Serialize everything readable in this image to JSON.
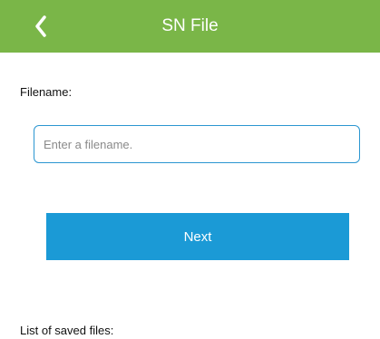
{
  "header": {
    "title": "SN File",
    "background_color": "#7ab648",
    "back_icon": "chevron-left-icon"
  },
  "form": {
    "filename_label": "Filename:",
    "filename_value": "",
    "filename_placeholder": "Enter a filename.",
    "input_border_color": "#2b96d1",
    "next_label": "Next",
    "next_button_color": "#1b9ad6"
  },
  "saved_files": {
    "label": "List of saved files:"
  }
}
